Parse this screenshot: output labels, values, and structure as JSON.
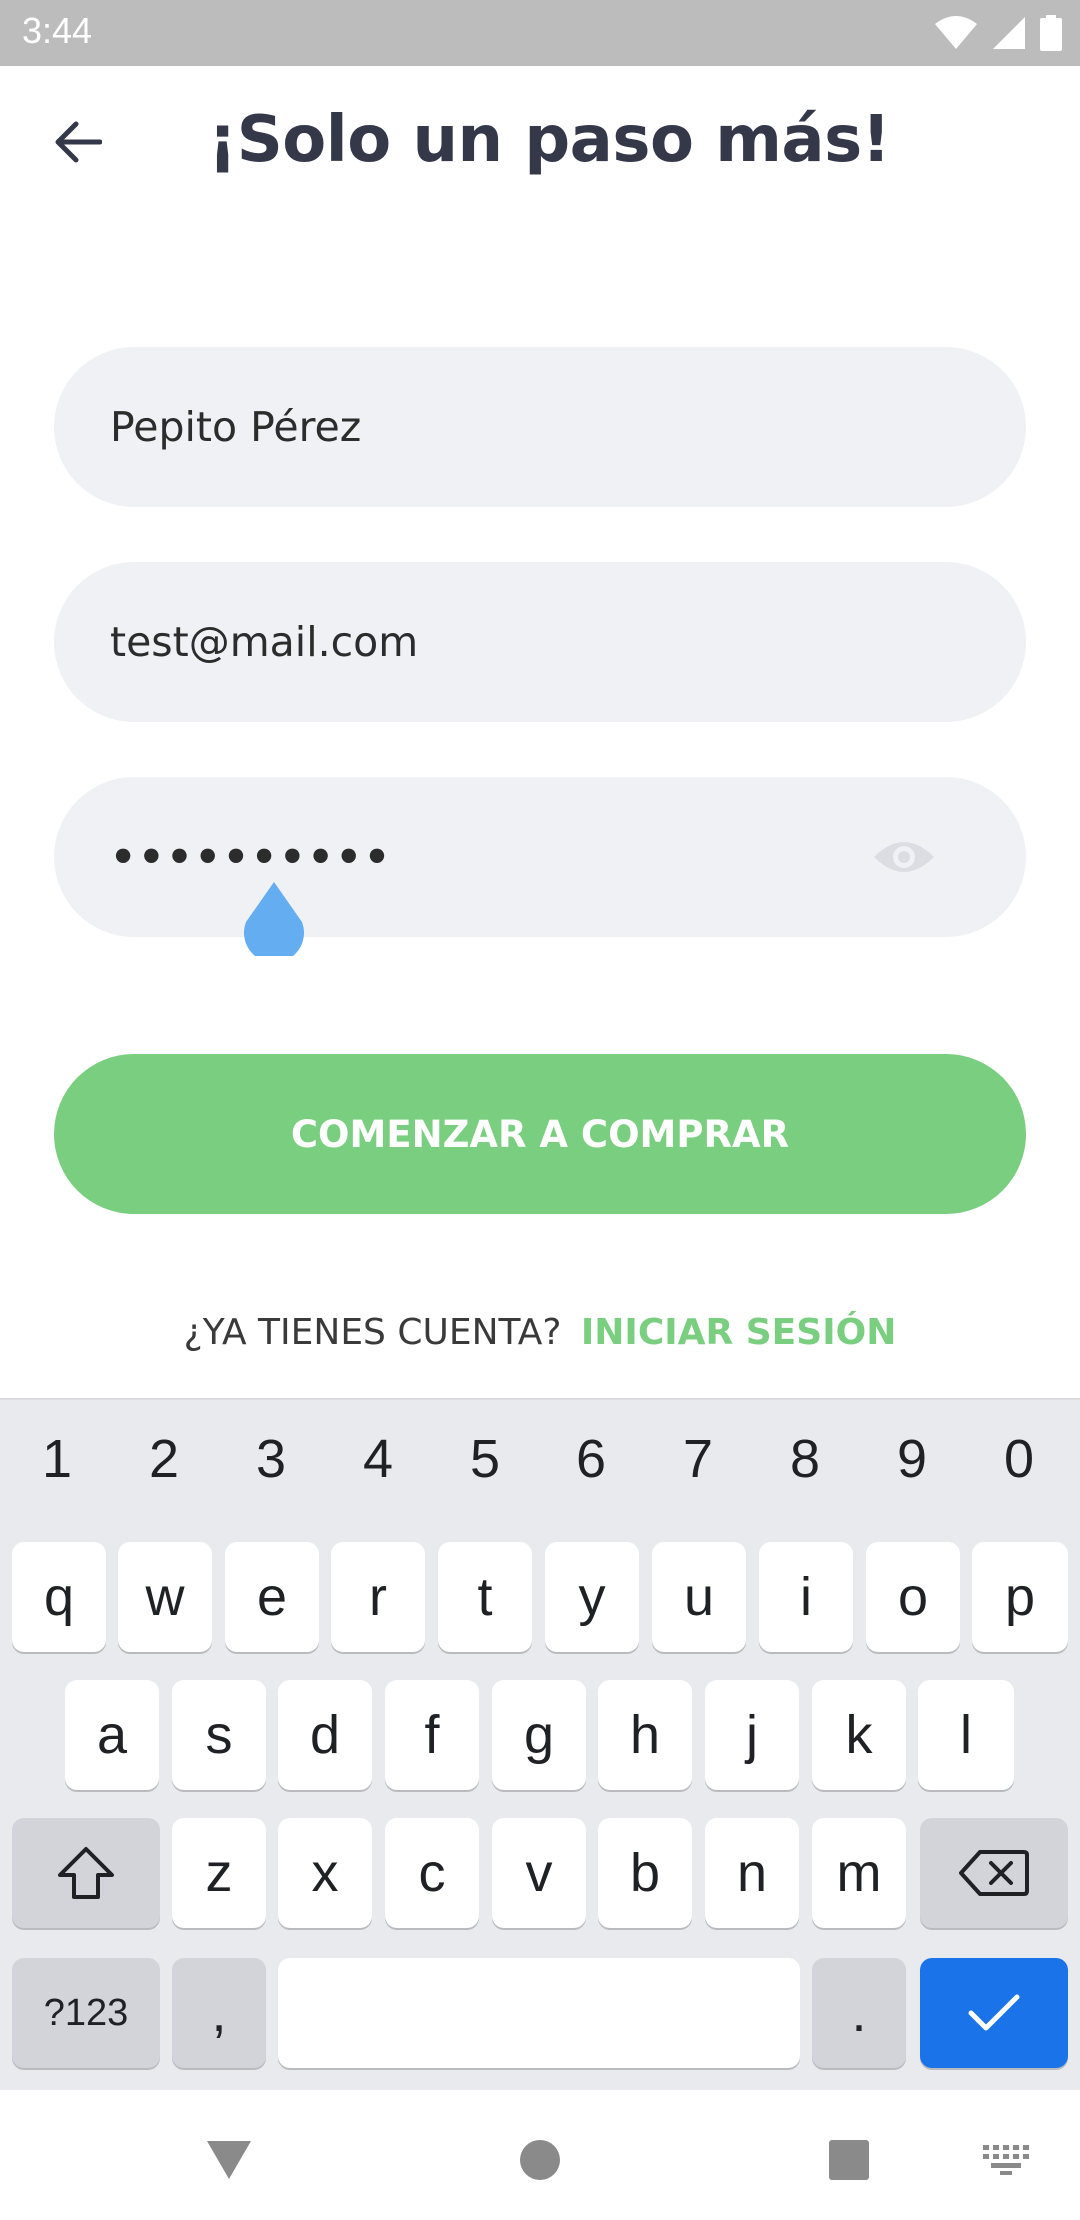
{
  "status_bar": {
    "time": "3:44"
  },
  "header": {
    "title": "¡Solo un paso más!"
  },
  "form": {
    "name_value": "Pepito Pérez",
    "email_value": "test@mail.com",
    "password_value": "••••••••••"
  },
  "primary_button": {
    "label": "COMENZAR A COMPRAR"
  },
  "login_prompt": {
    "question": "¿YA TIENES CUENTA?",
    "link": "INICIAR SESIÓN"
  },
  "keyboard": {
    "numbers": [
      "1",
      "2",
      "3",
      "4",
      "5",
      "6",
      "7",
      "8",
      "9",
      "0"
    ],
    "row1": [
      "q",
      "w",
      "e",
      "r",
      "t",
      "y",
      "u",
      "i",
      "o",
      "p"
    ],
    "row2": [
      "a",
      "s",
      "d",
      "f",
      "g",
      "h",
      "j",
      "k",
      "l"
    ],
    "row3": [
      "z",
      "x",
      "c",
      "v",
      "b",
      "n",
      "m"
    ],
    "symbols_key": "?123",
    "comma_key": ",",
    "period_key": "."
  },
  "colors": {
    "accent": "#7ace80",
    "title": "#353849",
    "field_bg": "#f0f1f5",
    "enter_key": "#1a73e8"
  }
}
